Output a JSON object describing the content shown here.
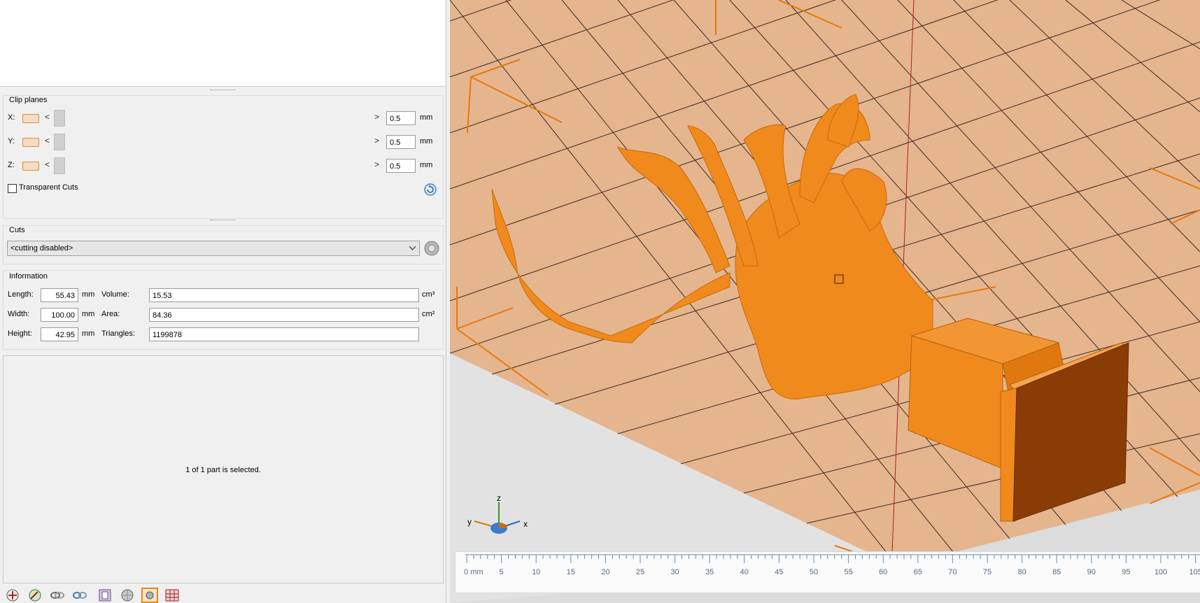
{
  "clip_planes": {
    "title": "Clip planes",
    "rows": [
      {
        "axis": "X:",
        "value": "0.5",
        "unit": "mm"
      },
      {
        "axis": "Y:",
        "value": "0.5",
        "unit": "mm"
      },
      {
        "axis": "Z:",
        "value": "0.5",
        "unit": "mm"
      }
    ],
    "transparent_cuts_label": "Transparent Cuts",
    "transparent_cuts_checked": false
  },
  "cuts": {
    "title": "Cuts",
    "selected": "<cutting disabled>"
  },
  "information": {
    "title": "Information",
    "length_label": "Length:",
    "length_value": "55.43",
    "length_unit": "mm",
    "width_label": "Width:",
    "width_value": "100.00",
    "width_unit": "mm",
    "height_label": "Height:",
    "height_value": "42.95",
    "height_unit": "mm",
    "volume_label": "Volume:",
    "volume_value": "15.53",
    "volume_unit": "cm³",
    "area_label": "Area:",
    "area_value": "84.36",
    "area_unit": "cm²",
    "triangles_label": "Triangles:",
    "triangles_value": "1199878"
  },
  "selection_status": "1 of 1 part is selected.",
  "toolbar_icons": [
    "add-part-icon",
    "wand-icon",
    "link-icon",
    "unlink-icon",
    "box-icon",
    "sphere-icon",
    "cut-view-icon",
    "grid-icon"
  ],
  "axis_gizmo": {
    "z": "z",
    "y": "y",
    "x": "x"
  },
  "ruler": {
    "unit_label": "0 mm",
    "ticks": [
      "5",
      "10",
      "15",
      "20",
      "25",
      "30",
      "35",
      "40",
      "45",
      "50",
      "55",
      "60",
      "65",
      "70",
      "75",
      "80",
      "85",
      "90",
      "95",
      "100",
      "105"
    ]
  },
  "colors": {
    "model": "#f08a1c",
    "bed": "#e6b890",
    "grid_line": "#3a2a20",
    "accent": "#e07a10"
  }
}
